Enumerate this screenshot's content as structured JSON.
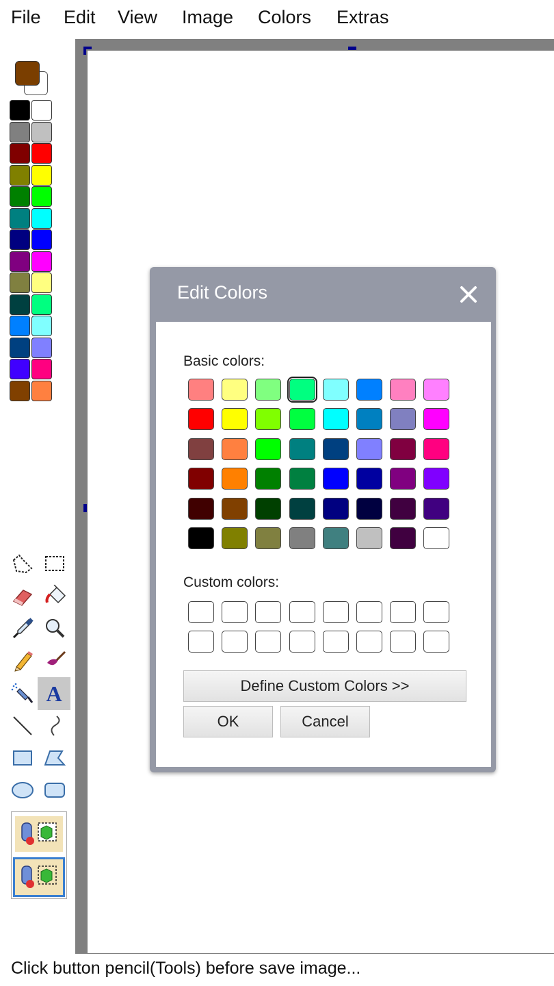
{
  "menu": [
    "File",
    "Edit",
    "View",
    "Image",
    "Colors",
    "Extras"
  ],
  "current_colors": {
    "foreground": "#7a3e00",
    "background": "#ffffff"
  },
  "palette": [
    [
      "#000000",
      "#ffffff"
    ],
    [
      "#808080",
      "#c0c0c0"
    ],
    [
      "#800000",
      "#ff0000"
    ],
    [
      "#808000",
      "#ffff00"
    ],
    [
      "#008000",
      "#00ff00"
    ],
    [
      "#008080",
      "#00ffff"
    ],
    [
      "#000080",
      "#0000ff"
    ],
    [
      "#800080",
      "#ff00ff"
    ],
    [
      "#808040",
      "#ffff80"
    ],
    [
      "#004040",
      "#00ff80"
    ],
    [
      "#0080ff",
      "#80ffff"
    ],
    [
      "#004080",
      "#8080ff"
    ],
    [
      "#4000ff",
      "#ff0080"
    ],
    [
      "#804000",
      "#ff8040"
    ]
  ],
  "tools": [
    {
      "name": "free-select-tool",
      "icon": "free-select-icon"
    },
    {
      "name": "rect-select-tool",
      "icon": "rect-select-icon"
    },
    {
      "name": "eraser-tool",
      "icon": "eraser-icon"
    },
    {
      "name": "fill-tool",
      "icon": "paint-bucket-icon"
    },
    {
      "name": "color-picker-tool",
      "icon": "eyedropper-icon"
    },
    {
      "name": "magnifier-tool",
      "icon": "magnifier-icon"
    },
    {
      "name": "pencil-tool",
      "icon": "pencil-icon"
    },
    {
      "name": "brush-tool",
      "icon": "brush-icon"
    },
    {
      "name": "airbrush-tool",
      "icon": "airbrush-icon"
    },
    {
      "name": "text-tool",
      "icon": "text-icon",
      "label": "A",
      "active": true
    },
    {
      "name": "line-tool",
      "icon": "line-icon"
    },
    {
      "name": "curve-tool",
      "icon": "curve-icon"
    },
    {
      "name": "rectangle-tool",
      "icon": "rectangle-icon"
    },
    {
      "name": "polygon-tool",
      "icon": "polygon-icon"
    },
    {
      "name": "ellipse-tool",
      "icon": "ellipse-icon"
    },
    {
      "name": "rounded-rect-tool",
      "icon": "rounded-rectangle-icon"
    }
  ],
  "tool_options": [
    "opaque-background-icon",
    "transparent-background-icon"
  ],
  "dialog": {
    "title": "Edit Colors",
    "close_icon": "close-icon",
    "basic_colors_label": "Basic colors:",
    "basic_colors": [
      [
        "#ff8080",
        "#ffff80",
        "#80ff80",
        "#00ff80",
        "#80ffff",
        "#0080ff",
        "#ff80c0",
        "#ff80ff"
      ],
      [
        "#ff0000",
        "#ffff00",
        "#80ff00",
        "#00ff40",
        "#00ffff",
        "#0080c0",
        "#8080c0",
        "#ff00ff"
      ],
      [
        "#804040",
        "#ff8040",
        "#00ff00",
        "#008080",
        "#004080",
        "#8080ff",
        "#800040",
        "#ff0080"
      ],
      [
        "#800000",
        "#ff8000",
        "#008000",
        "#008040",
        "#0000ff",
        "#0000a0",
        "#800080",
        "#8000ff"
      ],
      [
        "#400000",
        "#804000",
        "#004000",
        "#004040",
        "#000080",
        "#000040",
        "#400040",
        "#400080"
      ],
      [
        "#000000",
        "#808000",
        "#808040",
        "#808080",
        "#408080",
        "#c0c0c0",
        "#400040",
        "#ffffff"
      ]
    ],
    "selected_basic": "#00ff80",
    "custom_colors_label": "Custom colors:",
    "custom_colors": [
      [
        "#ffffff",
        "#ffffff",
        "#ffffff",
        "#ffffff",
        "#ffffff",
        "#ffffff",
        "#ffffff",
        "#ffffff"
      ],
      [
        "#ffffff",
        "#ffffff",
        "#ffffff",
        "#ffffff",
        "#ffffff",
        "#ffffff",
        "#ffffff",
        "#ffffff"
      ]
    ],
    "define_button": "Define Custom Colors >>",
    "ok_button": "OK",
    "cancel_button": "Cancel"
  },
  "status_text": "Click button pencil(Tools) before save image..."
}
